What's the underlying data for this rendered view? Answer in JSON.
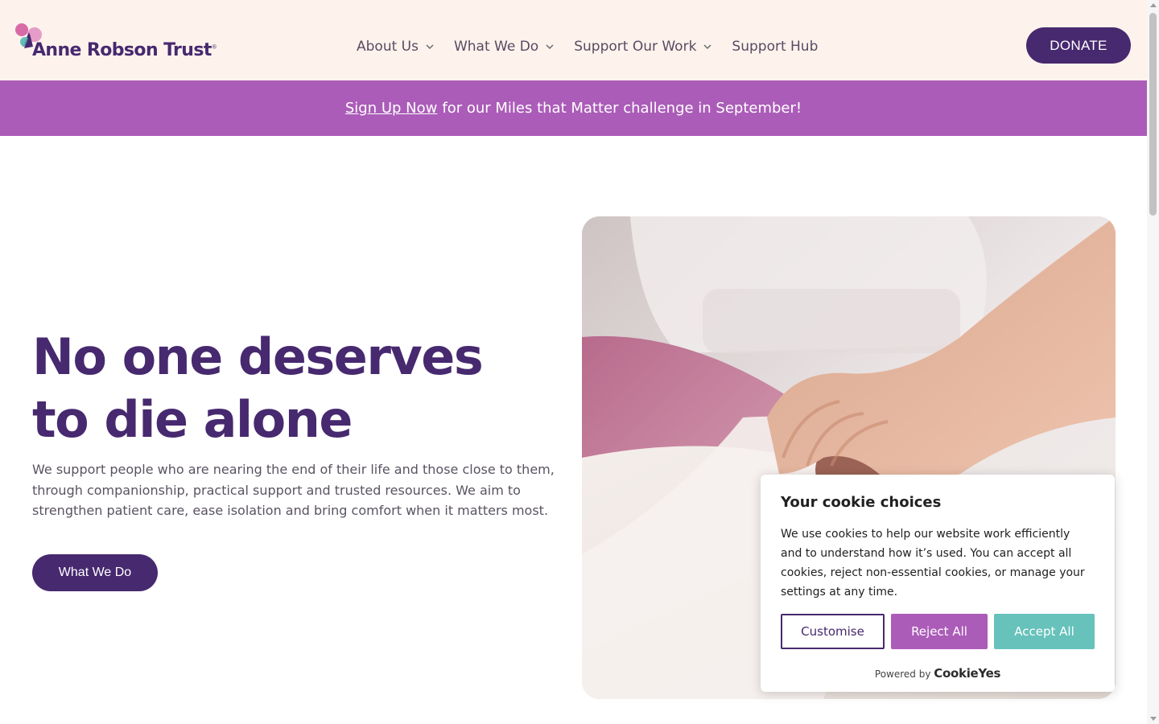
{
  "header": {
    "logo_text": "Anne Robson Trust",
    "logo_mark": "®",
    "nav": [
      {
        "label": "About Us",
        "has_dropdown": true
      },
      {
        "label": "What We Do",
        "has_dropdown": true
      },
      {
        "label": "Support Our Work",
        "has_dropdown": true
      },
      {
        "label": "Support Hub",
        "has_dropdown": false
      }
    ],
    "donate_label": "DONATE"
  },
  "banner": {
    "link_text": "Sign Up Now",
    "text": "for our Miles that Matter challenge in September!"
  },
  "hero": {
    "title_line1": "No one deserves",
    "title_line2": "to die alone",
    "body": "We support people who are nearing the end of their life and those close to them, through companionship, practical support and trusted resources. We aim to strengthen patient care, ease isolation and bring comfort when it matters most.",
    "button_label": "What We Do",
    "image_icon": "hand-holding-hand-photo"
  },
  "cookie": {
    "title": "Your cookie choices",
    "body": "We use cookies to help our website work efficiently and to understand how it’s used. You can accept all cookies, reject non-essential cookies, or manage your settings at any time.",
    "customise_label": "Customise",
    "reject_label": "Reject All",
    "accept_label": "Accept All",
    "powered_by": "Powered by",
    "powered_brand": "CookieYes"
  },
  "colors": {
    "brand_purple": "#47296f",
    "banner_purple": "#ab5cb8",
    "accept_teal": "#66c2bb",
    "header_bg": "#fdf3ec"
  }
}
